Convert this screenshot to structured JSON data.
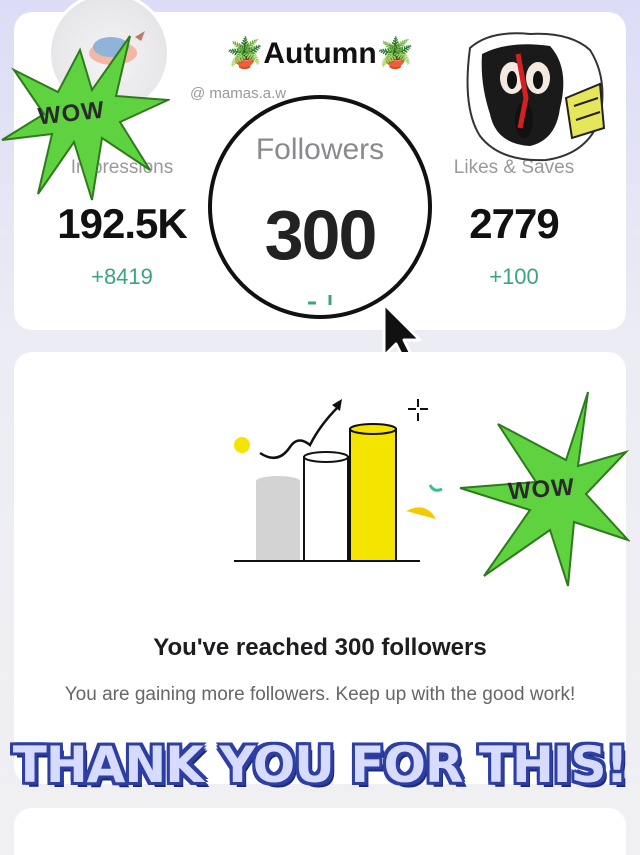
{
  "profile": {
    "username": "🪴Autumn🪴",
    "handle": "@ mamas.a.w"
  },
  "stats": [
    {
      "label": "Impressions",
      "value": "192.5K",
      "delta": "+8419"
    },
    {
      "label": "Followers",
      "value": "300",
      "delta": "+4"
    },
    {
      "label": "Likes & Saves",
      "value": "2779",
      "delta": "+100"
    }
  ],
  "stickers": {
    "burst_left_text": "WOW",
    "burst_right_text": "WOW",
    "burst_color": "#5fd33f",
    "caption": "THANK YOU FOR THIS!"
  },
  "milestone": {
    "title": "You've reached 300 followers",
    "body": "You are gaining more followers. Keep up with the good work!"
  },
  "colors": {
    "accent_green": "#3aa57c",
    "bar_yellow": "#f5e400"
  }
}
